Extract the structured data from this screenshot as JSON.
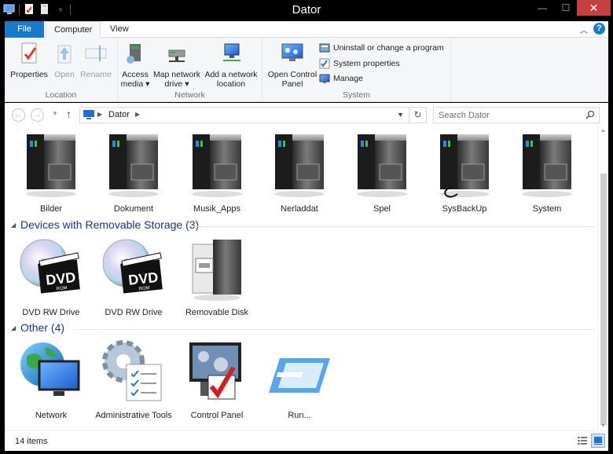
{
  "window": {
    "title": "Dator"
  },
  "ribbon_tabs": [
    {
      "label": "File"
    },
    {
      "label": "Computer"
    },
    {
      "label": "View"
    }
  ],
  "ribbon": {
    "location": {
      "label": "Location",
      "buttons": [
        {
          "label": "Properties",
          "enabled": true
        },
        {
          "label": "Open",
          "enabled": false
        },
        {
          "label": "Rename",
          "enabled": false
        }
      ]
    },
    "network": {
      "label": "Network",
      "access_media": [
        "Access",
        "media ▾"
      ],
      "map_network_drive": [
        "Map network",
        "drive ▾"
      ],
      "add_network_location": [
        "Add a network",
        "location"
      ]
    },
    "system": {
      "label": "System",
      "open_control_panel": [
        "Open Control",
        "Panel"
      ],
      "uninstall": "Uninstall or change a program",
      "system_properties": "System properties",
      "manage": "Manage"
    }
  },
  "address": {
    "crumb": "Dator",
    "search_placeholder": "Search Dator"
  },
  "drives": [
    {
      "label": "Bilder"
    },
    {
      "label": "Dokument"
    },
    {
      "label": "Musik_Apps"
    },
    {
      "label": "Nerladdat"
    },
    {
      "label": "Spel"
    },
    {
      "label": "SysBackUp"
    },
    {
      "label": "System"
    }
  ],
  "sections": {
    "removable": {
      "title": "Devices with Removable Storage (3)",
      "items": [
        {
          "label": "DVD RW Drive",
          "icon": "dvd-drive-icon"
        },
        {
          "label": "DVD RW Drive",
          "icon": "dvd-drive-icon"
        },
        {
          "label": "Removable Disk",
          "icon": "removable-disk-icon"
        }
      ]
    },
    "other": {
      "title": "Other (4)",
      "items": [
        {
          "label": "Network",
          "icon": "network-icon"
        },
        {
          "label": "Administrative Tools",
          "icon": "administrative-tools-icon"
        },
        {
          "label": "Control Panel",
          "icon": "control-panel-icon"
        },
        {
          "label": "Run...",
          "icon": "run-icon"
        }
      ]
    }
  },
  "status": {
    "item_count": "14 items"
  },
  "colors": {
    "file_tab": "#1979ca",
    "section_title": "#1e3287",
    "close_button": "#c74040"
  }
}
